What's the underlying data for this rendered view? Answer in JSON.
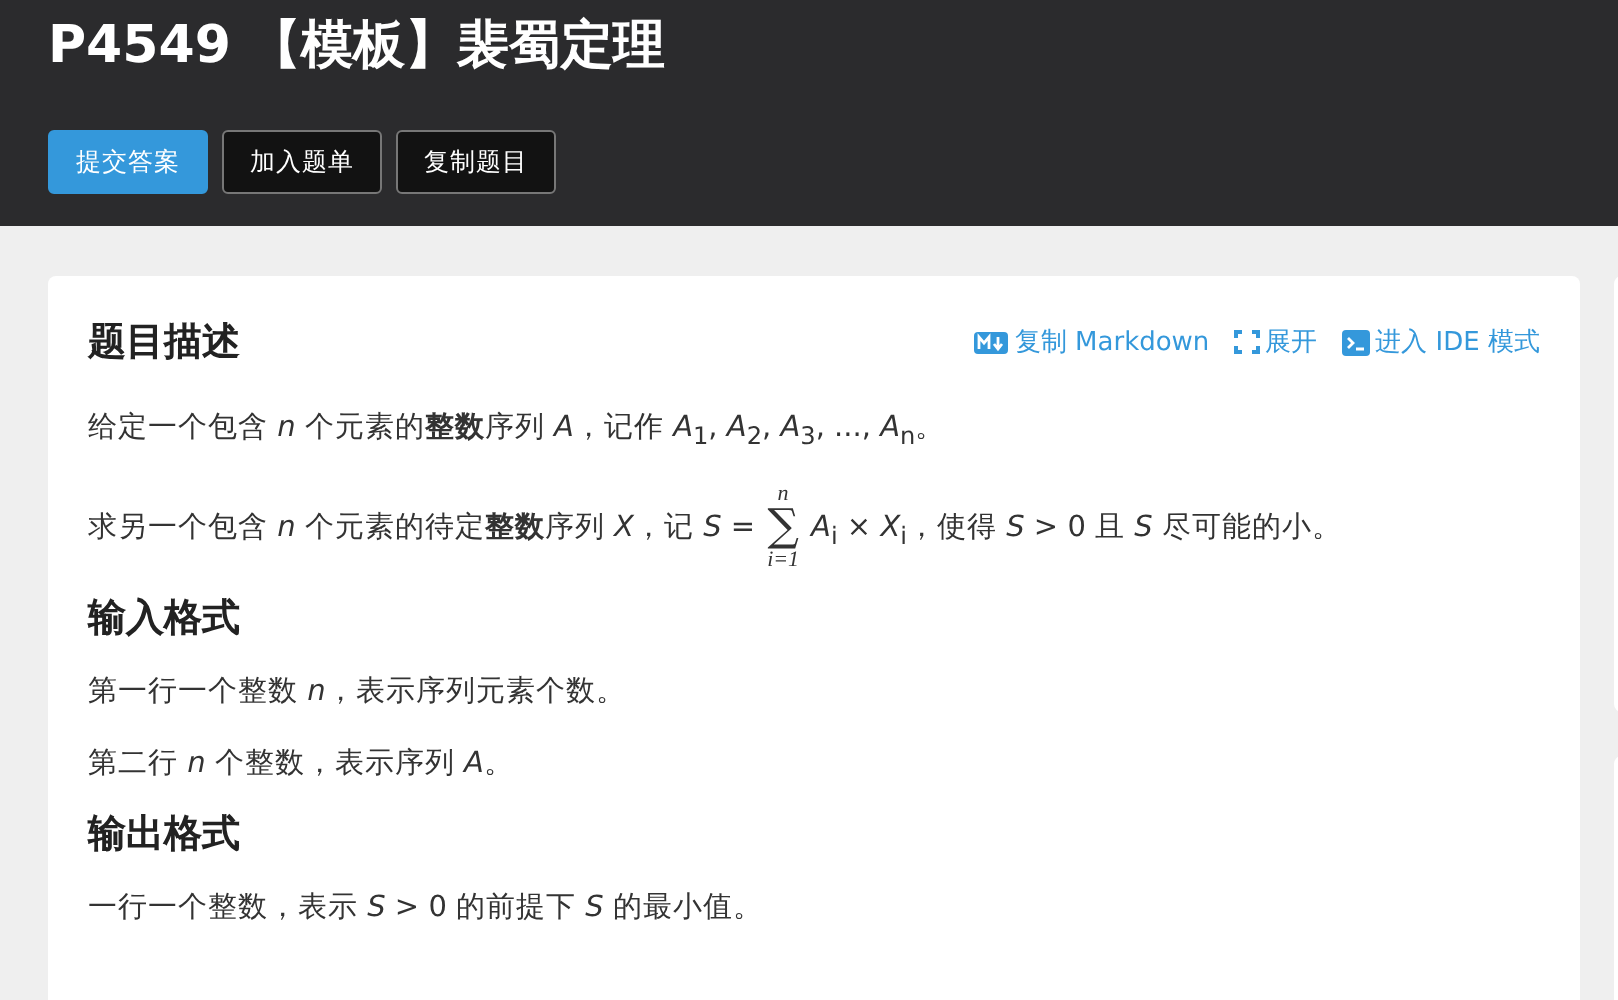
{
  "header": {
    "title": "P4549 【模板】裴蜀定理",
    "buttons": [
      {
        "label": "提交答案",
        "primary": true
      },
      {
        "label": "加入题单",
        "primary": false
      },
      {
        "label": "复制题目",
        "primary": false
      }
    ]
  },
  "card": {
    "actions": [
      {
        "label": "复制 Markdown",
        "kind": "markdown"
      },
      {
        "label": "展开",
        "kind": "expand"
      },
      {
        "label": "进入 IDE 模式",
        "kind": "terminal"
      }
    ],
    "sections": [
      {
        "heading": "题目描述",
        "paragraphs": [
          {
            "kind": "text",
            "text": "给定一个包含 *n* 个元素的**整数**序列 *A*，记作 *A*$_{1}$, *A*$_{2}$, *A*$_{3}$, ..., *A*$_{n}$。"
          },
          {
            "kind": "sum",
            "before": "求另一个包含 *n* 个元素的待定**整数**序列 *X*，记 *S* =",
            "upper": "n",
            "symbol": "∑",
            "lower": "i=1",
            "after": "*A*$_{i}$ × *X*$_{i}$，使得 *S* > 0 且 *S* 尽可能的小。"
          }
        ]
      },
      {
        "heading": "输入格式",
        "paragraphs": [
          {
            "kind": "text",
            "text": "第一行一个整数 *n*，表示序列元素个数。"
          },
          {
            "kind": "text",
            "text": "第二行 *n* 个整数，表示序列 *A*。"
          }
        ]
      },
      {
        "heading": "输出格式",
        "paragraphs": [
          {
            "kind": "text",
            "text": "一行一个整数，表示 *S* > 0 的前提下 *S* 的最小值。"
          }
        ]
      }
    ]
  }
}
